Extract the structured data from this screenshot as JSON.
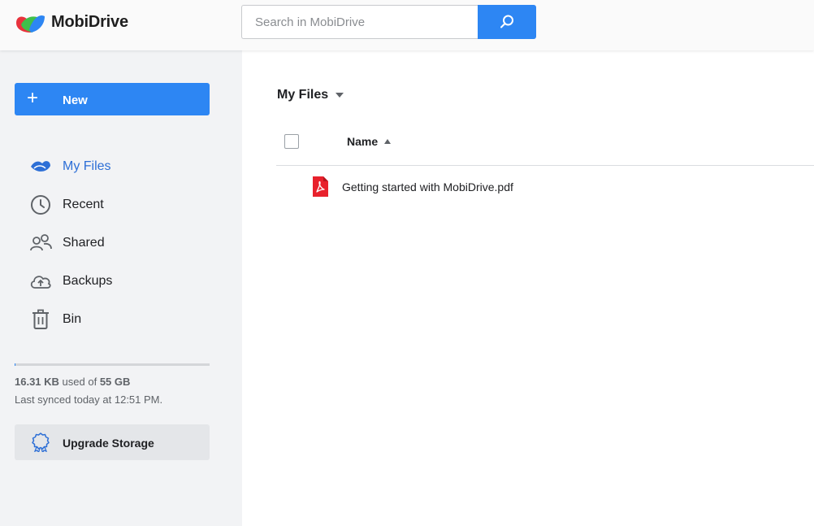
{
  "app": {
    "name": "MobiDrive"
  },
  "colors": {
    "accent": "#2d86f3",
    "active_nav": "#2d6fd6",
    "pdf_red": "#e8212c"
  },
  "search": {
    "placeholder": "Search in MobiDrive",
    "value": "",
    "button_icon": "search-icon"
  },
  "sidebar": {
    "new_button": {
      "icon": "plus-icon",
      "label": "New"
    },
    "items": [
      {
        "id": "my-files",
        "icon": "my-files-icon",
        "label": "My Files",
        "active": true
      },
      {
        "id": "recent",
        "icon": "clock-icon",
        "label": "Recent",
        "active": false
      },
      {
        "id": "shared",
        "icon": "people-icon",
        "label": "Shared",
        "active": false
      },
      {
        "id": "backups",
        "icon": "cloud-upload-icon",
        "label": "Backups",
        "active": false
      },
      {
        "id": "bin",
        "icon": "trash-icon",
        "label": "Bin",
        "active": false
      }
    ],
    "storage": {
      "used": "16.31 KB",
      "used_of": "used of",
      "total": "55 GB",
      "fill_fraction": 0.005,
      "sync_text": "Last synced today at 12:51 PM."
    },
    "upgrade": {
      "icon": "badge-icon",
      "label": "Upgrade Storage"
    }
  },
  "main": {
    "breadcrumb": {
      "label": "My Files",
      "caret_icon": "caret-down-icon"
    },
    "table": {
      "columns": [
        {
          "label": "Name",
          "sort": "ascending"
        }
      ],
      "rows": [
        {
          "icon": "pdf-icon",
          "name": "Getting started with MobiDrive.pdf"
        }
      ]
    }
  }
}
